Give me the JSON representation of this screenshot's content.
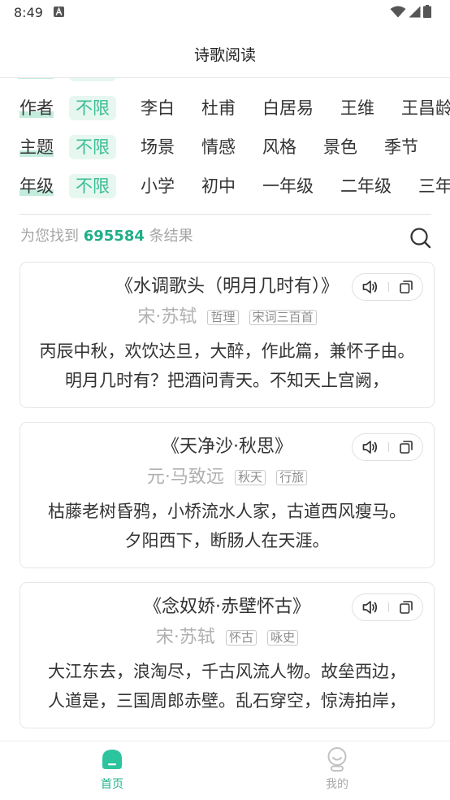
{
  "status_bar": {
    "time": "8:49",
    "icons": [
      "a-notification-icon",
      "wifi-icon",
      "signal-icon",
      "battery-icon"
    ]
  },
  "header": {
    "title": "诗歌阅读"
  },
  "filters": [
    {
      "label": "作者",
      "selected": "不限",
      "options": [
        "李白",
        "杜甫",
        "白居易",
        "王维",
        "王昌龄"
      ]
    },
    {
      "label": "主题",
      "selected": "不限",
      "options": [
        "场景",
        "情感",
        "风格",
        "景色",
        "季节"
      ]
    },
    {
      "label": "年级",
      "selected": "不限",
      "options": [
        "小学",
        "初中",
        "一年级",
        "二年级",
        "三年"
      ]
    }
  ],
  "results": {
    "prefix": "为您找到",
    "count": "695584",
    "suffix": "条结果",
    "search_icon": "search-icon"
  },
  "poems": [
    {
      "title": "《水调歌头（明月几时有）》",
      "author": "宋·苏轼",
      "tags": [
        "哲理",
        "宋词三百首"
      ],
      "lines": [
        "丙辰中秋，欢饮达旦，大醉，作此篇，兼怀子由。",
        "明月几时有？把酒问青天。不知天上宫阙，"
      ],
      "actions": [
        "speaker-icon",
        "copy-icon"
      ]
    },
    {
      "title": "《天净沙·秋思》",
      "author": "元·马致远",
      "tags": [
        "秋天",
        "行旅"
      ],
      "lines": [
        "枯藤老树昏鸦，小桥流水人家，古道西风瘦马。",
        "夕阳西下，断肠人在天涯。"
      ],
      "actions": [
        "speaker-icon",
        "copy-icon"
      ]
    },
    {
      "title": "《念奴娇·赤壁怀古》",
      "author": "宋·苏轼",
      "tags": [
        "怀古",
        "咏史"
      ],
      "lines": [
        "大江东去，浪淘尽，千古风流人物。故垒西边，",
        "人道是，三国周郎赤壁。乱石穿空，惊涛拍岸，"
      ],
      "actions": [
        "speaker-icon",
        "copy-icon"
      ]
    }
  ],
  "bottom_nav": [
    {
      "label": "首页",
      "icon": "home-icon",
      "active": true
    },
    {
      "label": "我的",
      "icon": "profile-icon",
      "active": false
    }
  ],
  "colors": {
    "accent": "#22b38c",
    "chip_bg": "#e6f7f0",
    "chip_text": "#3bbd93",
    "label_highlight": "#c3ecdd",
    "muted_text": "#a5a5a5",
    "border": "#e6e6e6"
  }
}
